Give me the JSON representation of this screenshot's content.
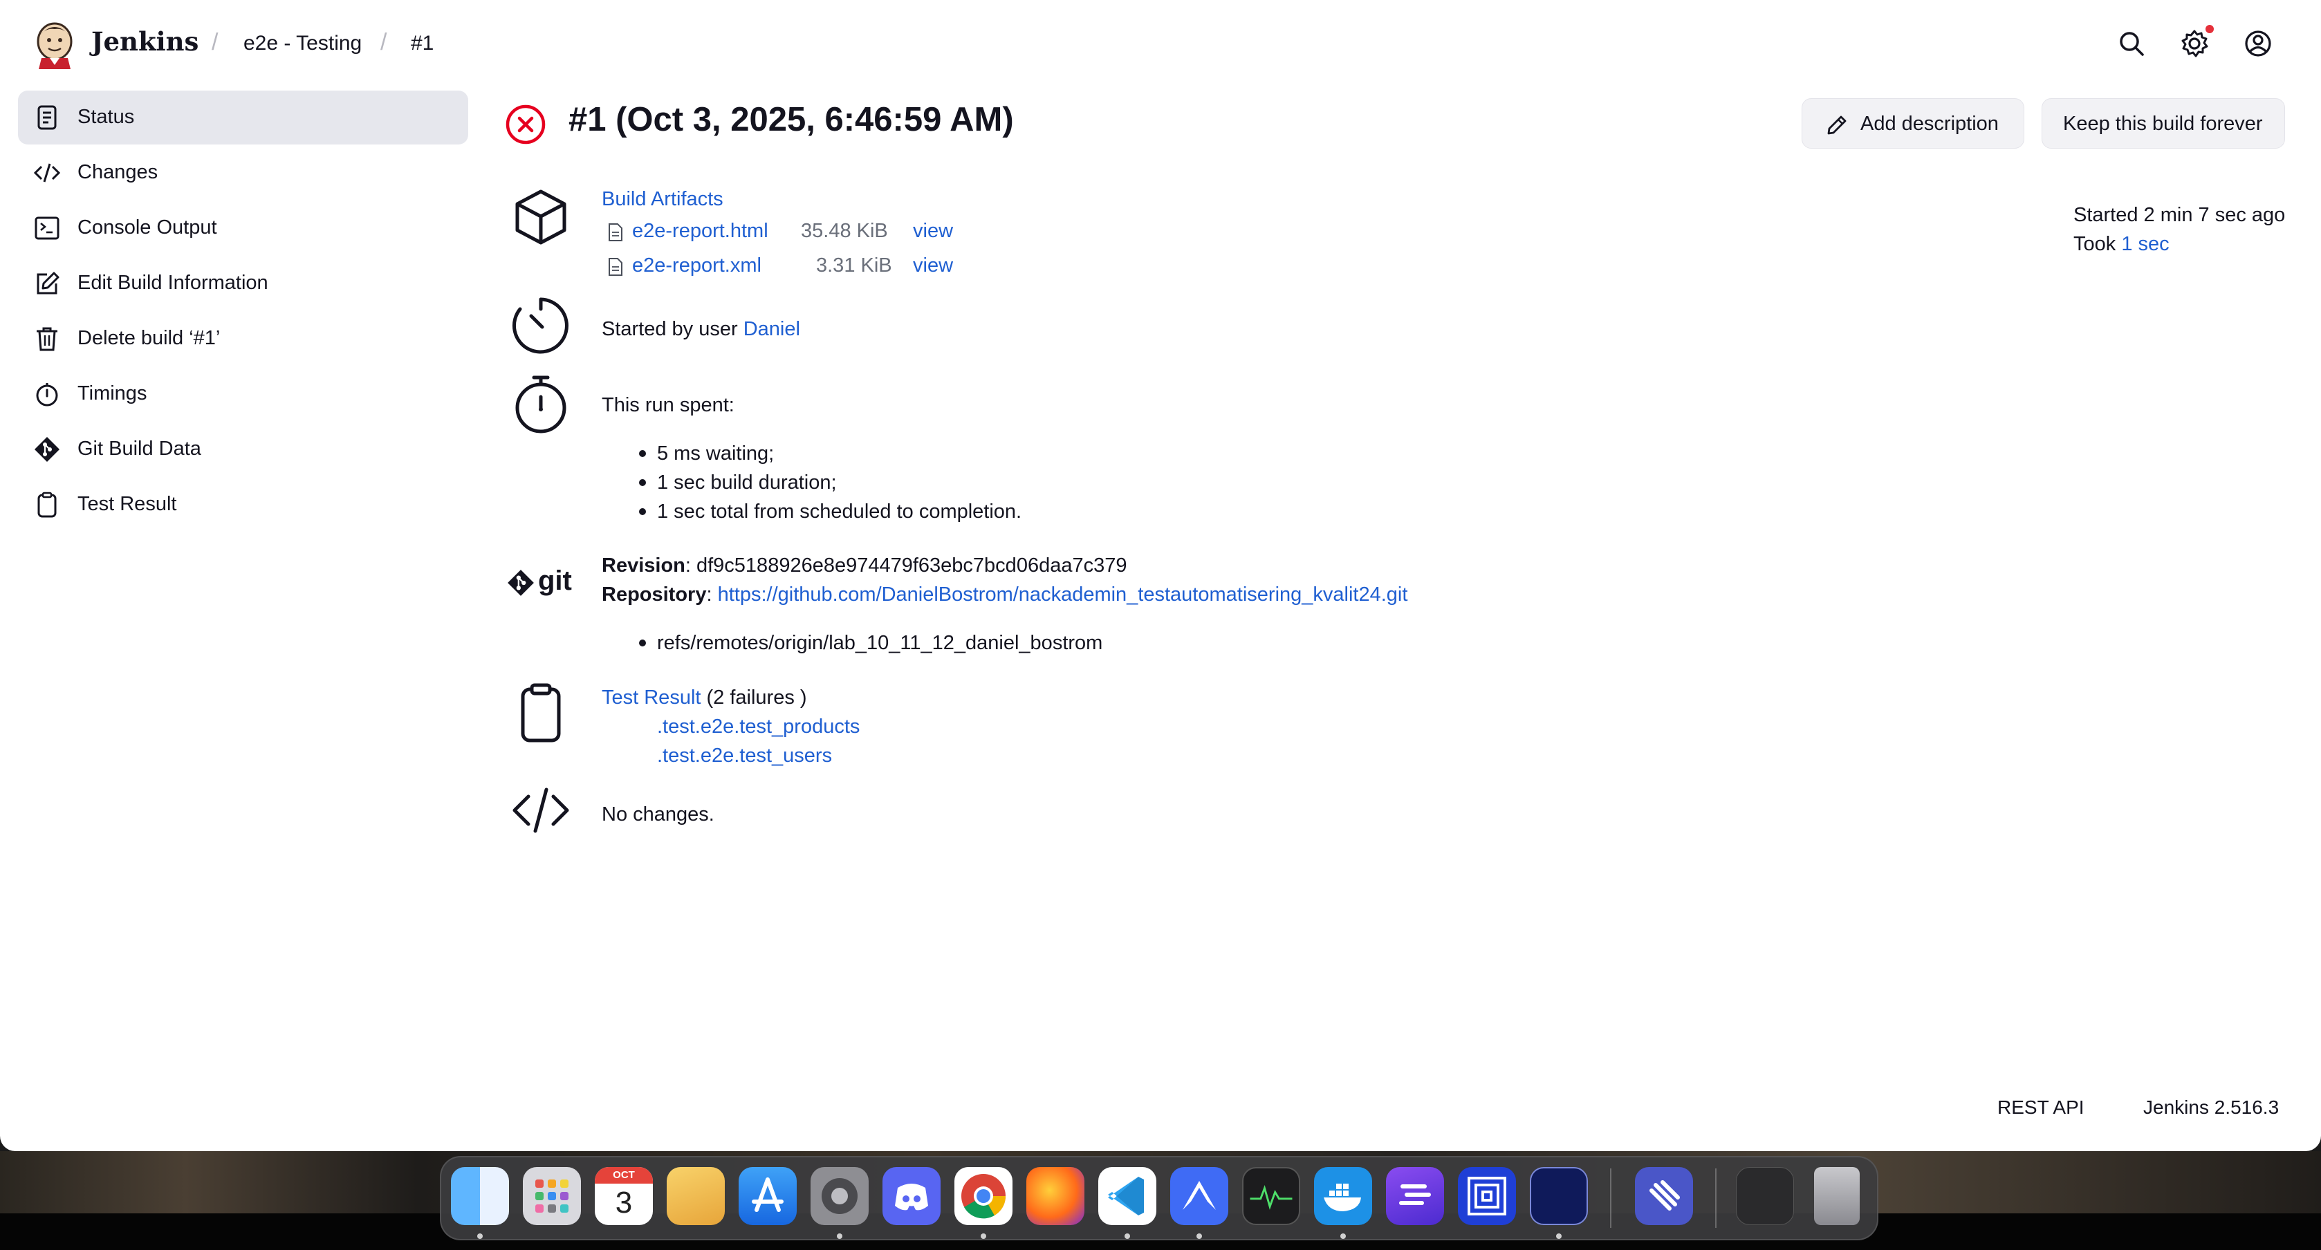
{
  "app": {
    "brand": "Jenkins"
  },
  "breadcrumb": {
    "items": [
      "e2e - Testing",
      "#1"
    ]
  },
  "header_icons": [
    "search-icon",
    "gear-icon",
    "user-icon"
  ],
  "sidebar": {
    "items": [
      {
        "label": "Status",
        "icon": "document-icon",
        "active": true
      },
      {
        "label": "Changes",
        "icon": "code-icon"
      },
      {
        "label": "Console Output",
        "icon": "terminal-icon"
      },
      {
        "label": "Edit Build Information",
        "icon": "edit-icon"
      },
      {
        "label": "Delete build ‘#1’",
        "icon": "trash-icon"
      },
      {
        "label": "Timings",
        "icon": "stopwatch-icon"
      },
      {
        "label": "Git Build Data",
        "icon": "git-icon"
      },
      {
        "label": "Test Result",
        "icon": "clipboard-icon"
      }
    ]
  },
  "build": {
    "title": "#1 (Oct 3, 2025, 6:46:59 AM)",
    "status": "failed",
    "status_color": "#e6001f",
    "actions": {
      "add_description": "Add description",
      "keep_forever": "Keep this build forever"
    },
    "started_ago": "Started 2 min 7 sec ago",
    "took_label": "Took",
    "took_value": "1 sec"
  },
  "artifacts": {
    "heading": "Build Artifacts",
    "files": [
      {
        "name": "e2e-report.html",
        "size": "35.48 KiB",
        "action": "view"
      },
      {
        "name": "e2e-report.xml",
        "size": "3.31 KiB",
        "action": "view"
      }
    ]
  },
  "cause": {
    "prefix": "Started by user",
    "user": "Daniel"
  },
  "timing": {
    "heading": "This run spent:",
    "items": [
      "5 ms waiting;",
      "1 sec build duration;",
      "1 sec total from scheduled to completion."
    ]
  },
  "git": {
    "logo_text": "git",
    "revision_label": "Revision",
    "revision": ": df9c5188926e8e974479f63ebc7bcd06daa7c379",
    "repository_label": "Repository",
    "repository_colon": ":",
    "repository_url": "https://github.com/DanielBostrom/nackademin_testautomatisering_kvalit24.git",
    "branches": [
      "refs/remotes/origin/lab_10_11_12_daniel_bostrom"
    ]
  },
  "tests": {
    "link": "Test Result",
    "summary": "(2 failures )",
    "failures": [
      ".test.e2e.test_products",
      ".test.e2e.test_users"
    ]
  },
  "changes": {
    "text": "No changes."
  },
  "footer": {
    "rest_api": "REST API",
    "version": "Jenkins 2.516.3"
  },
  "dock": {
    "calendar_month": "OCT",
    "calendar_day": "3",
    "apps": [
      "finder-icon",
      "launchpad-icon",
      "calendar-icon",
      "preview-icon",
      "app-store-icon",
      "system-settings-icon",
      "discord-icon",
      "chrome-icon",
      "firefox-icon",
      "vscode-icon",
      "nordvpn-icon",
      "activity-monitor-icon",
      "docker-icon",
      "notion-calendar-icon",
      "frame-icon",
      "terminal-app-icon",
      "linear-icon",
      "screenshot-icon",
      "trash-icon"
    ]
  }
}
